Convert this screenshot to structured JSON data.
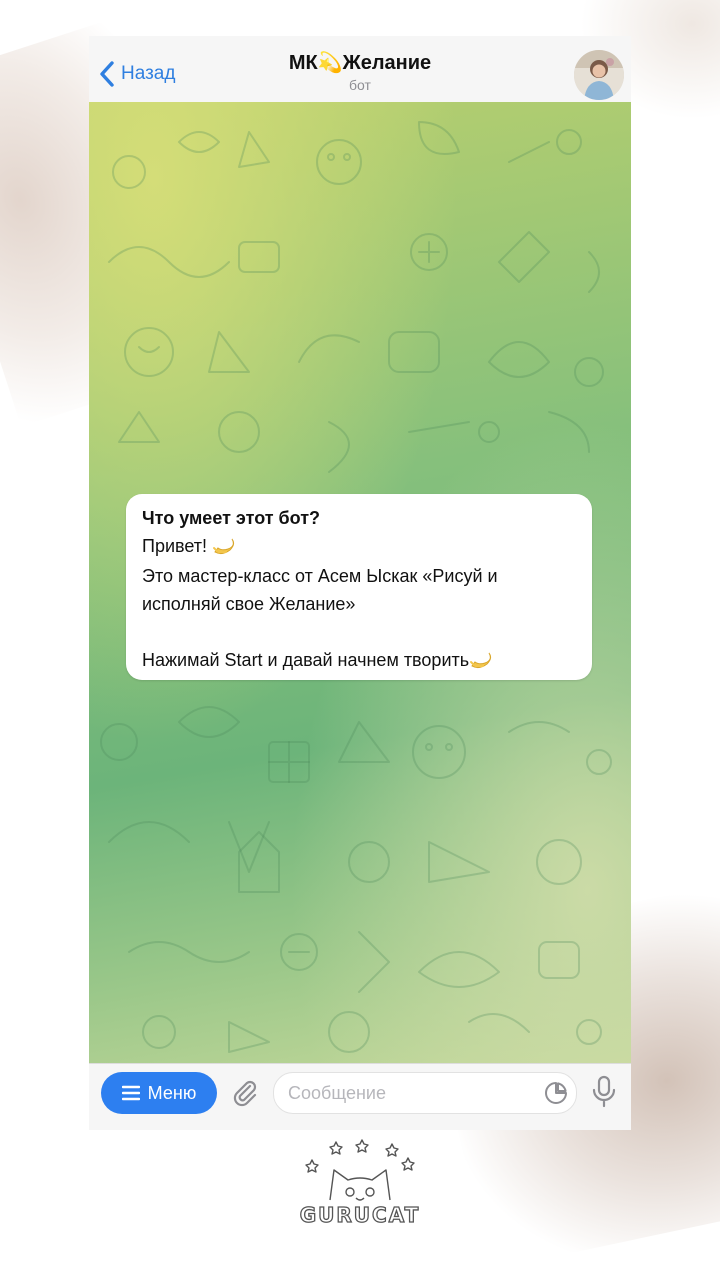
{
  "header": {
    "back_label": "Назад",
    "title": "МК💫Желание",
    "subtitle": "бот"
  },
  "message": {
    "title": "Что умеет этот бот?",
    "line1": "Привет!",
    "line2": "Это мастер-класс от Асем Ыскак «Рисуй и",
    "line3": "исполняй свое Желание»",
    "line4": "Нажимай Start и давай начнем творить"
  },
  "input_bar": {
    "menu_label": "Меню",
    "placeholder": "Сообщение"
  },
  "branding": {
    "logo_text": "GURUCAT"
  },
  "icons": {
    "back": "chevron-left-icon",
    "menu": "hamburger-icon",
    "attach": "paperclip-icon",
    "sticker": "sticker-icon",
    "mic": "microphone-icon",
    "emoji": "dizzy-emoji"
  },
  "colors": {
    "accent": "#2d7ff0",
    "chat_bg_top": "#b8cf6e",
    "chat_bg_mid": "#6cb47a",
    "bubble": "#ffffff"
  }
}
